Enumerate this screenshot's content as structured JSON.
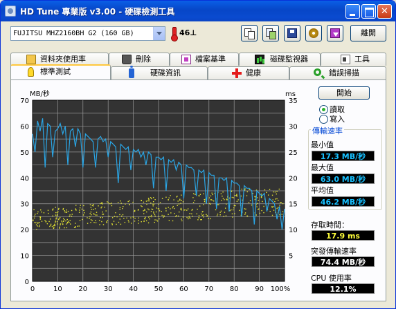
{
  "window": {
    "title": "HD Tune 專業版 v3.00 - 硬碟檢測工具"
  },
  "toolbar": {
    "drive": "FUJITSU MHZ2160BH G2 (160 GB)",
    "temperature": "46⊥",
    "exit_label": "離開"
  },
  "tabs_top": [
    {
      "label": "資料夾使用率",
      "icon": "folder-icon"
    },
    {
      "label": "刪除",
      "icon": "trash-icon"
    },
    {
      "label": "檔案基準",
      "icon": "file-benchmark-icon"
    },
    {
      "label": "磁碟監視器",
      "icon": "disk-monitor-icon"
    },
    {
      "label": "工具",
      "icon": "speaker-icon"
    }
  ],
  "tabs_bottom": [
    {
      "label": "標準測試",
      "icon": "lightbulb-icon",
      "active": true
    },
    {
      "label": "硬碟資訊",
      "icon": "info-icon"
    },
    {
      "label": "健康",
      "icon": "health-cross-icon"
    },
    {
      "label": "錯誤掃描",
      "icon": "magnifier-icon"
    }
  ],
  "controls": {
    "start_label": "開始",
    "read_label": "讀取",
    "write_label": "寫入",
    "read_selected": true
  },
  "stats": {
    "transfer_rate_title": "傳輸速率",
    "min_label": "最小值",
    "min_value": "17.3 MB/秒",
    "max_label": "最大值",
    "max_value": "63.0 MB/秒",
    "avg_label": "平均值",
    "avg_value": "46.2 MB/秒",
    "access_label": "存取時間：",
    "access_value": "17.9 ms",
    "burst_label": "突發傳輸速率",
    "burst_value": "74.4 MB/秒",
    "cpu_label": "CPU 使用率",
    "cpu_value": "12.1%"
  },
  "colors": {
    "plot_bg": "#333333",
    "grid": "#9a9a9a",
    "transfer_line": "#2aa6e6",
    "access_points": "#e6e632"
  },
  "chart_data": {
    "type": "line",
    "ylabel_left": "MB/秒",
    "ylabel_right": "ms",
    "ylim_left": [
      0,
      70
    ],
    "ylim_right": [
      0,
      35
    ],
    "left_ticks": [
      "0",
      "10",
      "20",
      "30",
      "40",
      "50",
      "60",
      "70"
    ],
    "right_ticks": [
      "5",
      "10",
      "15",
      "20",
      "25",
      "30",
      "35"
    ],
    "x_ticks": [
      "0",
      "10",
      "20",
      "30",
      "40",
      "50",
      "60",
      "70",
      "80",
      "90",
      "100%"
    ],
    "grid": true,
    "series": [
      {
        "name": "transfer_rate",
        "axis": "left",
        "x": [
          0,
          1,
          2,
          3,
          4,
          5,
          6,
          7,
          8,
          9,
          10,
          11,
          12,
          13,
          14,
          15,
          16,
          17,
          18,
          19,
          20,
          21,
          22,
          23,
          24,
          25,
          26,
          27,
          28,
          29,
          30,
          31,
          32,
          33,
          34,
          35,
          36,
          37,
          38,
          39,
          40,
          41,
          42,
          43,
          44,
          45,
          46,
          47,
          48,
          49,
          50,
          51,
          52,
          53,
          54,
          55,
          56,
          57,
          58,
          59,
          60,
          61,
          62,
          63,
          64,
          65,
          66,
          67,
          68,
          69,
          70,
          71,
          72,
          73,
          74,
          75,
          76,
          77,
          78,
          79,
          80,
          81,
          82,
          83,
          84,
          85,
          86,
          87,
          88,
          89,
          90,
          91,
          92,
          93,
          94,
          95,
          96,
          97,
          98,
          99,
          100
        ],
        "values": [
          57,
          50,
          62,
          58,
          63,
          44,
          61,
          60,
          48,
          58,
          59,
          61,
          57,
          60,
          45,
          58,
          59,
          52,
          59,
          57,
          44,
          57,
          56,
          55,
          54,
          44,
          55,
          56,
          54,
          55,
          48,
          54,
          53,
          52,
          38,
          53,
          52,
          51,
          52,
          43,
          51,
          50,
          51,
          48,
          50,
          45,
          50,
          49,
          36,
          48,
          48,
          47,
          48,
          35,
          47,
          46,
          47,
          43,
          46,
          45,
          32,
          45,
          44,
          44,
          43,
          33,
          43,
          42,
          43,
          30,
          42,
          41,
          41,
          28,
          40,
          40,
          39,
          40,
          27,
          39,
          38,
          38,
          37,
          25,
          37,
          36,
          36,
          35,
          22,
          35,
          34,
          33,
          34,
          27,
          32,
          31,
          30,
          24,
          29,
          20,
          28
        ]
      }
    ],
    "access_time_ms": {
      "axis": "right",
      "min": 9,
      "max": 18,
      "average": 17.9,
      "spread": "scatter across full width, most points between 10 and 17 ms"
    }
  }
}
